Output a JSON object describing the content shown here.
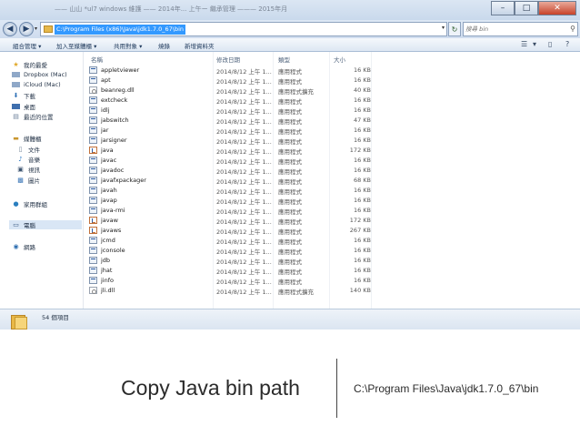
{
  "window": {
    "title": "—— 山山 *ul7 windows 維護 —— 2014年... 上午ー 繼承管理 ——— 2015年月",
    "controls": {
      "minimize": "–",
      "maximize": "□",
      "close": "✕"
    }
  },
  "address_bar": {
    "path": "C:\\Program Files (x86)\\Java\\jdk1.7.0_67\\bin",
    "search_placeholder": "搜尋 bin",
    "back_icon": "back-arrow-icon",
    "forward_icon": "forward-arrow-icon"
  },
  "toolbar": {
    "items": [
      "組合管理 ▾",
      "加入至媒體櫃 ▾",
      "共用對象 ▾",
      "燒錄",
      "新增資料夾"
    ]
  },
  "nav": {
    "items": [
      {
        "label": "我的最愛",
        "icon": "star-icon"
      },
      {
        "label": "Dropbox (Mac)",
        "icon": "folder-icon"
      },
      {
        "label": "iCloud (Mac)",
        "icon": "folder-icon"
      },
      {
        "label": "下載",
        "icon": "download-icon"
      },
      {
        "label": "桌面",
        "icon": "desktop-icon"
      },
      {
        "label": "最近的位置",
        "icon": "recent-icon"
      },
      {
        "label": "媒體櫃",
        "icon": "library-icon"
      },
      {
        "label": "文件",
        "icon": "document-icon"
      },
      {
        "label": "音樂",
        "icon": "music-icon"
      },
      {
        "label": "視訊",
        "icon": "video-icon"
      },
      {
        "label": "圖片",
        "icon": "picture-icon"
      },
      {
        "label": "家用群組",
        "icon": "homegroup-icon"
      },
      {
        "label": "電腦",
        "icon": "computer-icon"
      },
      {
        "label": "網路",
        "icon": "network-icon"
      }
    ]
  },
  "file_list": {
    "columns": [
      "名稱",
      "修改日期",
      "類型",
      "大小"
    ],
    "rows": [
      {
        "name": "appletviewer",
        "date": "2014/8/12 上午 1...",
        "type": "應用程式",
        "size": "16 KB",
        "kind": "exe"
      },
      {
        "name": "apt",
        "date": "2014/8/12 上午 1...",
        "type": "應用程式",
        "size": "16 KB",
        "kind": "exe"
      },
      {
        "name": "beanreg.dll",
        "date": "2014/8/12 上午 1...",
        "type": "應用程式擴充",
        "size": "40 KB",
        "kind": "dll"
      },
      {
        "name": "extcheck",
        "date": "2014/8/12 上午 1...",
        "type": "應用程式",
        "size": "16 KB",
        "kind": "exe"
      },
      {
        "name": "idlj",
        "date": "2014/8/12 上午 1...",
        "type": "應用程式",
        "size": "16 KB",
        "kind": "exe"
      },
      {
        "name": "jabswitch",
        "date": "2014/8/12 上午 1...",
        "type": "應用程式",
        "size": "47 KB",
        "kind": "exe"
      },
      {
        "name": "jar",
        "date": "2014/8/12 上午 1...",
        "type": "應用程式",
        "size": "16 KB",
        "kind": "exe"
      },
      {
        "name": "jarsigner",
        "date": "2014/8/12 上午 1...",
        "type": "應用程式",
        "size": "16 KB",
        "kind": "exe"
      },
      {
        "name": "java",
        "date": "2014/8/12 上午 1...",
        "type": "應用程式",
        "size": "172 KB",
        "kind": "java"
      },
      {
        "name": "javac",
        "date": "2014/8/12 上午 1...",
        "type": "應用程式",
        "size": "16 KB",
        "kind": "exe"
      },
      {
        "name": "javadoc",
        "date": "2014/8/12 上午 1...",
        "type": "應用程式",
        "size": "16 KB",
        "kind": "exe"
      },
      {
        "name": "javafxpackager",
        "date": "2014/8/12 上午 1...",
        "type": "應用程式",
        "size": "68 KB",
        "kind": "exe"
      },
      {
        "name": "javah",
        "date": "2014/8/12 上午 1...",
        "type": "應用程式",
        "size": "16 KB",
        "kind": "exe"
      },
      {
        "name": "javap",
        "date": "2014/8/12 上午 1...",
        "type": "應用程式",
        "size": "16 KB",
        "kind": "exe"
      },
      {
        "name": "java-rmi",
        "date": "2014/8/12 上午 1...",
        "type": "應用程式",
        "size": "16 KB",
        "kind": "exe"
      },
      {
        "name": "javaw",
        "date": "2014/8/12 上午 1...",
        "type": "應用程式",
        "size": "172 KB",
        "kind": "java"
      },
      {
        "name": "javaws",
        "date": "2014/8/12 上午 1...",
        "type": "應用程式",
        "size": "267 KB",
        "kind": "java"
      },
      {
        "name": "jcmd",
        "date": "2014/8/12 上午 1...",
        "type": "應用程式",
        "size": "16 KB",
        "kind": "exe"
      },
      {
        "name": "jconsole",
        "date": "2014/8/12 上午 1...",
        "type": "應用程式",
        "size": "16 KB",
        "kind": "exe"
      },
      {
        "name": "jdb",
        "date": "2014/8/12 上午 1...",
        "type": "應用程式",
        "size": "16 KB",
        "kind": "exe"
      },
      {
        "name": "jhat",
        "date": "2014/8/12 上午 1...",
        "type": "應用程式",
        "size": "16 KB",
        "kind": "exe"
      },
      {
        "name": "jinfo",
        "date": "2014/8/12 上午 1...",
        "type": "應用程式",
        "size": "16 KB",
        "kind": "exe"
      },
      {
        "name": "jli.dll",
        "date": "2014/8/12 上午 1...",
        "type": "應用程式擴充",
        "size": "140 KB",
        "kind": "dll"
      }
    ]
  },
  "status_bar": {
    "item_count": "54 個項目"
  },
  "slide": {
    "caption": "Copy Java bin path",
    "path": "C:\\Program Files\\Java\\jdk1.7.0_67\\bin"
  }
}
